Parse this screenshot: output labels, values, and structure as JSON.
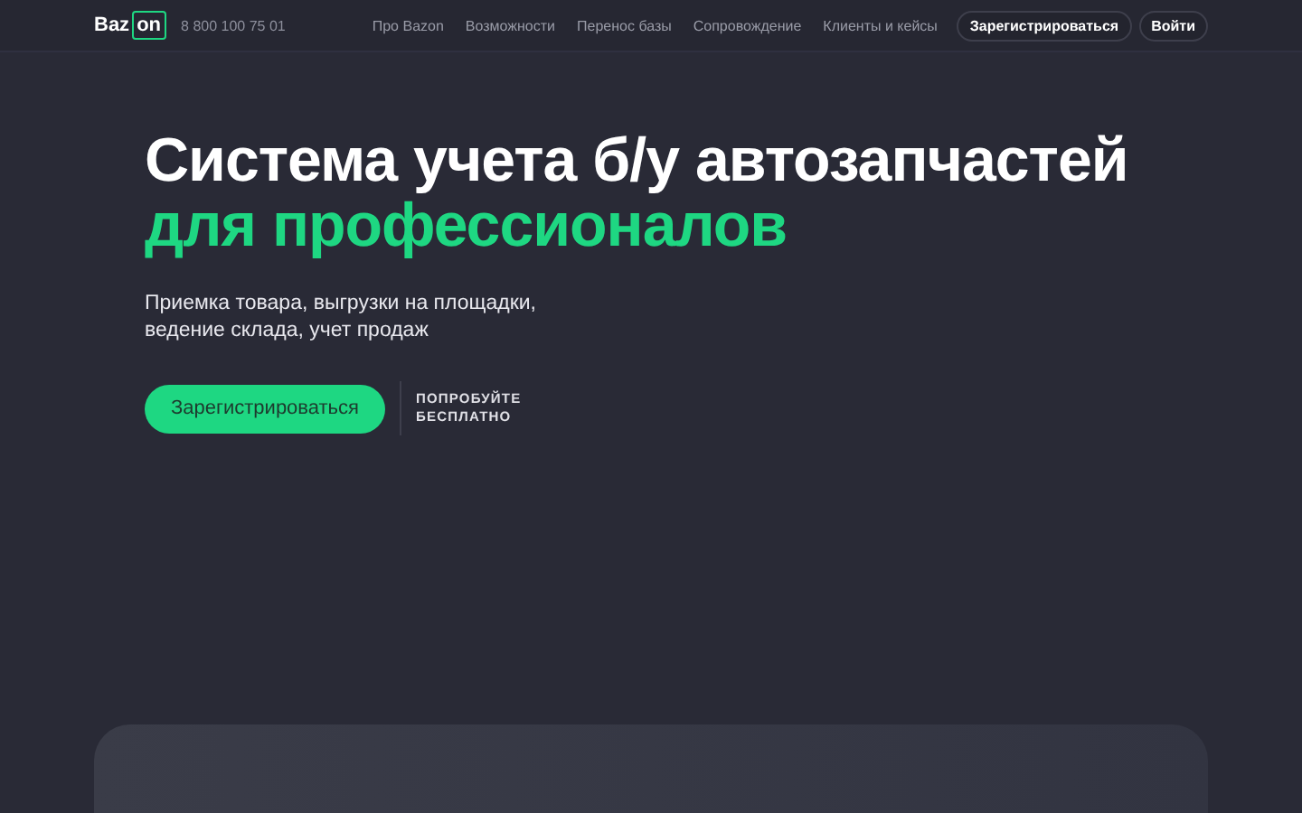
{
  "header": {
    "logo": {
      "text": "Baz",
      "boxed": "on"
    },
    "phone": "8 800 100 75 01",
    "nav": [
      "Про Bazon",
      "Возможности",
      "Перенос базы",
      "Сопровождение",
      "Клиенты и кейсы"
    ],
    "buttons": [
      "Зарегистрироваться",
      "Войти"
    ]
  },
  "hero": {
    "title": "Система учета б/у автозапчастей",
    "title_accent": "для профессионалов",
    "subtitle": "Приемка товара, выгрузки на площадки,\nведение склада, учет продаж",
    "cta": "Зарегистрироваться",
    "note": "ПОПРОБУЙТЕ\nБЕСПЛАТНО"
  }
}
